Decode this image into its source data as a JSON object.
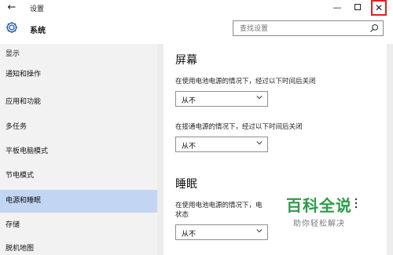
{
  "window": {
    "title": "设置",
    "back_glyph": "←",
    "minimize_glyph": "—",
    "close_glyph": "✕",
    "close_highlight_color": "#e0201c"
  },
  "header": {
    "section_title": "系统",
    "search_placeholder": "查找设置"
  },
  "sidebar": {
    "items": [
      {
        "label": "显示"
      },
      {
        "label": "通知和操作"
      },
      {
        "label": "应用和功能"
      },
      {
        "label": "多任务"
      },
      {
        "label": "平板电脑模式"
      },
      {
        "label": "节电模式"
      },
      {
        "label": "电源和睡眠",
        "selected": true
      },
      {
        "label": "存储"
      },
      {
        "label": "脱机地图"
      }
    ],
    "selected_color": "#c2d6f4"
  },
  "main": {
    "screen_heading": "屏幕",
    "screen_battery_label": "在使用电池电源的情况下，经过以下时间后关闭",
    "screen_battery_value": "从不",
    "screen_plugged_label": "在接通电源的情况下，经过以下时间后关闭",
    "screen_plugged_value": "从不",
    "sleep_heading": "睡眠",
    "sleep_battery_label_line1": "在使用电池电源的情况下，电",
    "sleep_battery_label_line2": "状态",
    "sleep_battery_value": "从不"
  },
  "watermark": {
    "title": "百科全说",
    "subtitle": "助你轻松解决",
    "color": "#2d9b48"
  }
}
